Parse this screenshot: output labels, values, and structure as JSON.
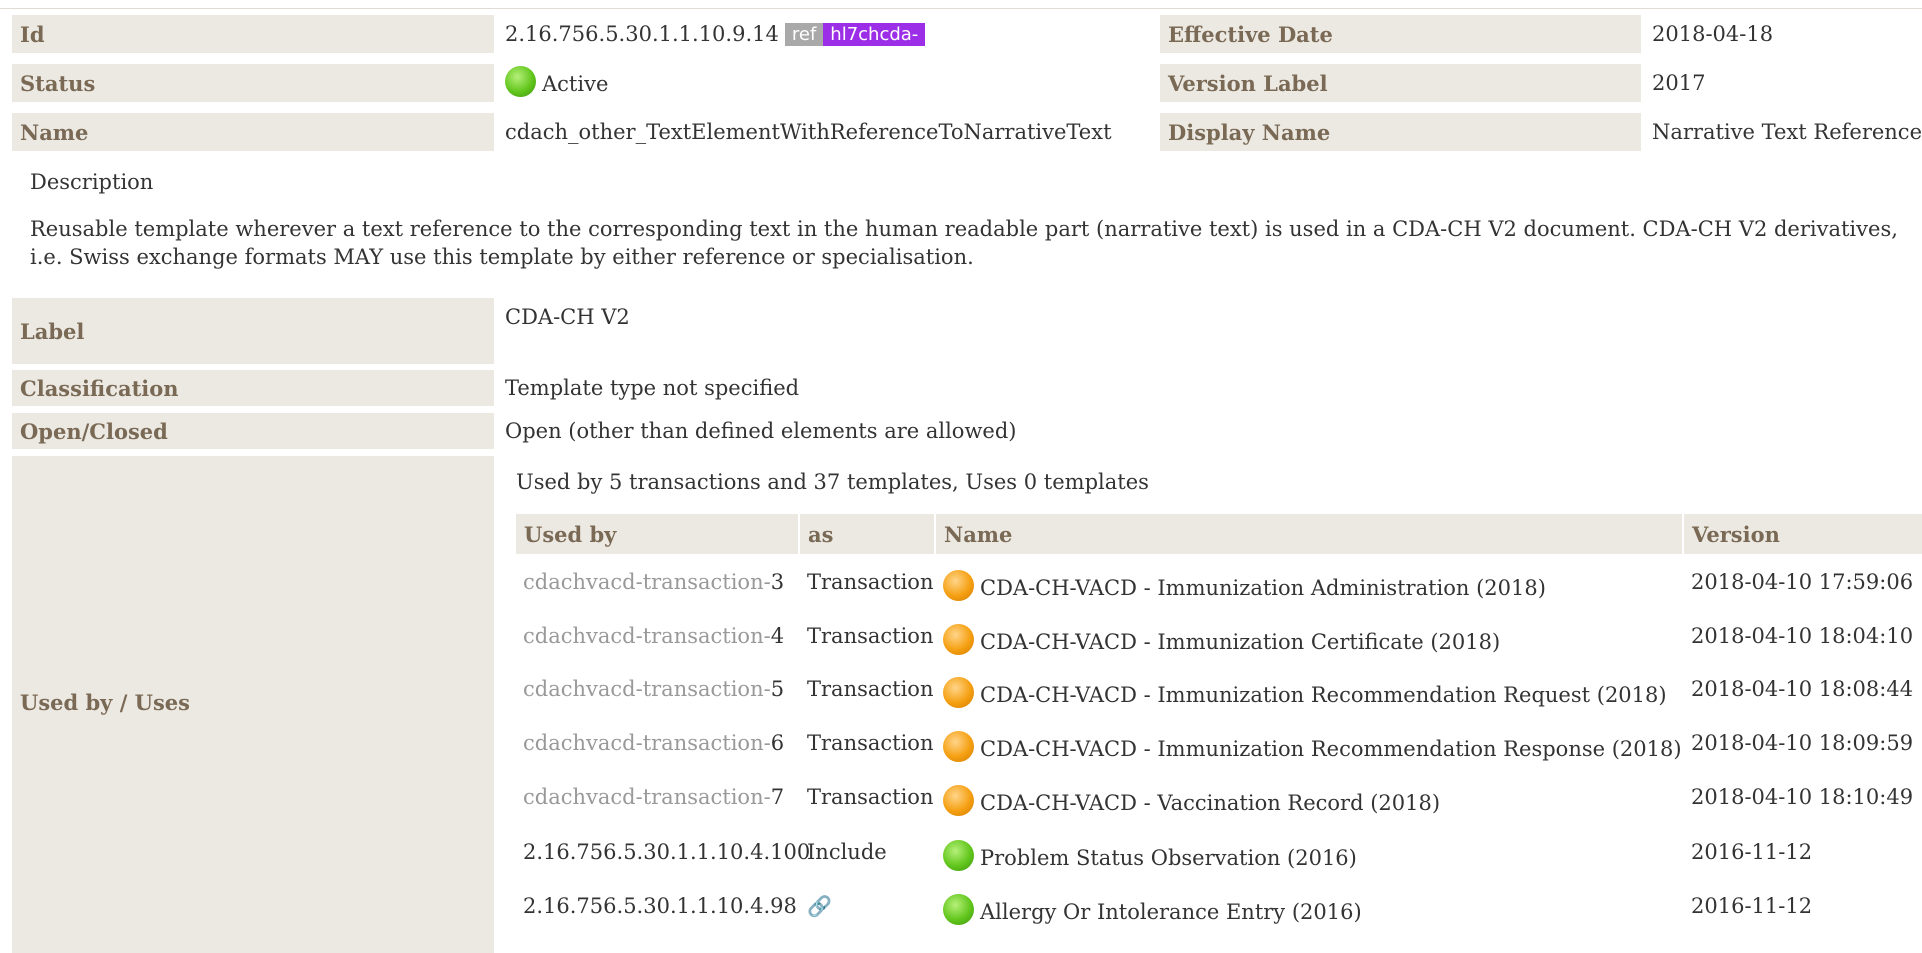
{
  "summary": {
    "id_label": "Id",
    "id_value": "2.16.756.5.30.1.1.10.9.14",
    "ref_badge": "ref",
    "prefix_badge": "hl7chcda-",
    "effective_date_label": "Effective Date",
    "effective_date_value": "2018-04-18",
    "status_label": "Status",
    "status_value": "Active",
    "version_label_label": "Version Label",
    "version_label_value": "2017",
    "name_label": "Name",
    "name_value": "cdach_other_TextElementWithReferenceToNarrativeText",
    "display_name_label": "Display Name",
    "display_name_value": "Narrative Text Reference"
  },
  "description": {
    "title": "Description",
    "text": "Reusable template wherever a text reference to the corresponding text in the human readable part (narrative text) is used in a CDA-CH V2 document. CDA-CH V2 derivatives, i.e. Swiss exchange formats MAY use this template by either reference or specialisation."
  },
  "details": {
    "label_label": "Label",
    "label_value": "CDA-CH V2",
    "classification_label": "Classification",
    "classification_value": "Template type not specified",
    "open_closed_label": "Open/Closed",
    "open_closed_value": "Open (other than defined elements are allowed)"
  },
  "uses": {
    "label": "Used by / Uses",
    "summary": "Used by 5 transactions and 37 templates, Uses 0 templates",
    "headers": {
      "used_by": "Used by",
      "as": "as",
      "name": "Name",
      "version": "Version"
    },
    "rows": [
      {
        "prefix": "cdachvacd-transaction-",
        "num": "3",
        "as": "Transaction",
        "status_color": "orange",
        "name": "CDA-CH-VACD - Immunization Administration (2018)",
        "version": "2018-04-10 17:59:06"
      },
      {
        "prefix": "cdachvacd-transaction-",
        "num": "4",
        "as": "Transaction",
        "status_color": "orange",
        "name": "CDA-CH-VACD - Immunization Certificate (2018)",
        "version": "2018-04-10 18:04:10"
      },
      {
        "prefix": "cdachvacd-transaction-",
        "num": "5",
        "as": "Transaction",
        "status_color": "orange",
        "name": "CDA-CH-VACD - Immunization Recommendation Request (2018)",
        "version": "2018-04-10 18:08:44"
      },
      {
        "prefix": "cdachvacd-transaction-",
        "num": "6",
        "as": "Transaction",
        "status_color": "orange",
        "name": "CDA-CH-VACD - Immunization Recommendation Response (2018)",
        "version": "2018-04-10 18:09:59"
      },
      {
        "prefix": "cdachvacd-transaction-",
        "num": "7",
        "as": "Transaction",
        "status_color": "orange",
        "name": "CDA-CH-VACD - Vaccination Record (2018)",
        "version": "2018-04-10 18:10:49"
      },
      {
        "id": "2.16.756.5.30.1.1.10.4.100",
        "as": "Include",
        "status_color": "green",
        "name": "Problem Status Observation (2016)",
        "version": "2016-11-12"
      },
      {
        "id": "2.16.756.5.30.1.1.10.4.98",
        "as_icon": "link-icon",
        "status_color": "green",
        "name": "Allergy Or Intolerance Entry (2016)",
        "version": "2016-11-12"
      }
    ]
  },
  "colors": {
    "label_bg": "#ece9e3",
    "label_text": "#7a6a55",
    "badge_prefix": "#9b2ee6",
    "badge_ref": "#a9a9a9"
  }
}
